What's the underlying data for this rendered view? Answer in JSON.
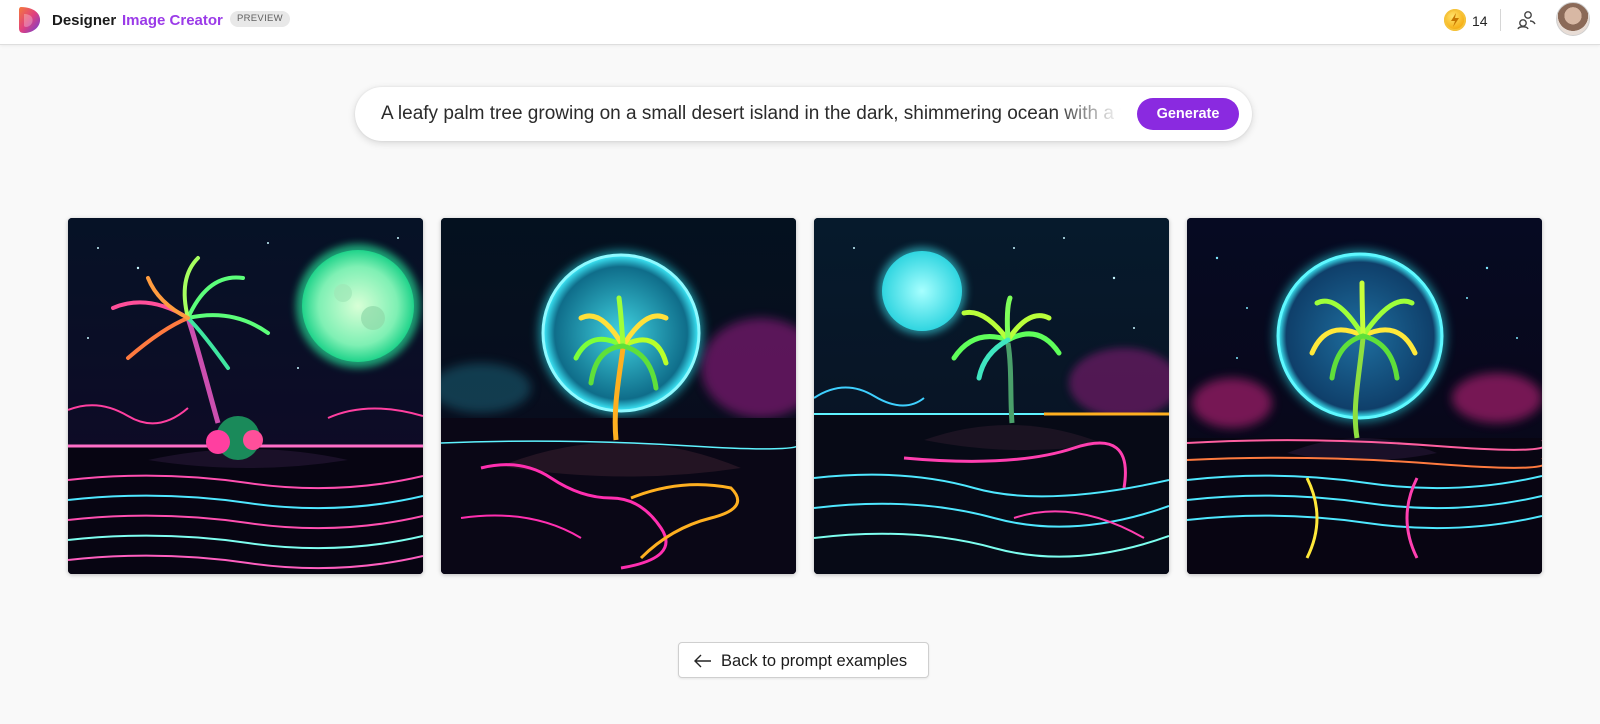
{
  "header": {
    "brand": "Designer",
    "product": "Image Creator",
    "badge": "PREVIEW",
    "coins": "14",
    "icons": [
      "designer-logo-icon",
      "coin-icon",
      "share-icon",
      "avatar"
    ]
  },
  "prompt": {
    "text": "A leafy palm tree growing on a small desert island in the dark, shimmering ocean with a f",
    "generate_label": "Generate"
  },
  "gallery": {
    "images": [
      {
        "alt": "neon palm island with green moon"
      },
      {
        "alt": "neon palm tree in front of cyan moon"
      },
      {
        "alt": "neon palm island with small cyan moon"
      },
      {
        "alt": "neon palm tree inside glowing cyan circle"
      }
    ]
  },
  "back_button": {
    "label": "Back to prompt examples"
  },
  "colors": {
    "accent": "#8a2ae0",
    "product": "#9b3be8",
    "background": "#f9f9f9"
  }
}
